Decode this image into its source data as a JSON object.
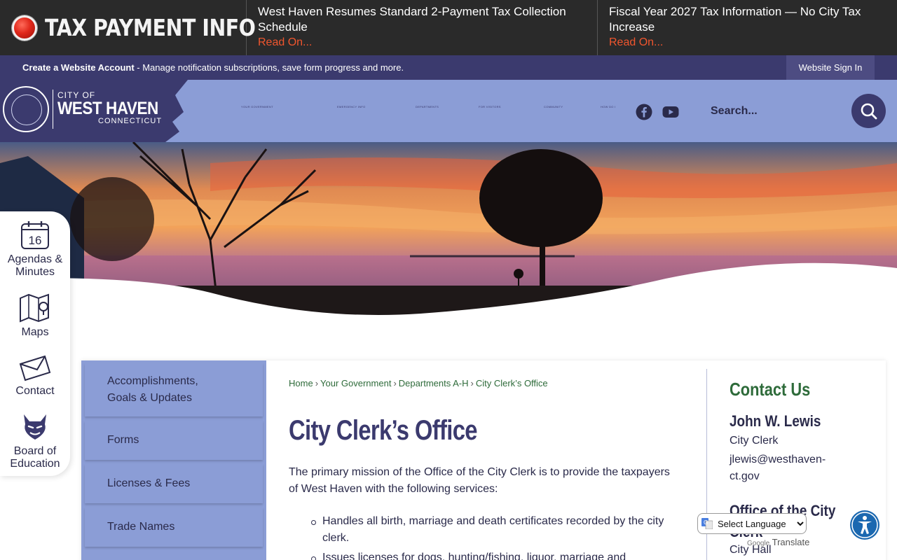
{
  "alert": {
    "label": "TAX PAYMENT INFO",
    "items": [
      {
        "text": "West Haven Resumes Standard 2-Payment Tax Collection Schedule",
        "link": "Read On..."
      },
      {
        "text": "Fiscal Year 2027 Tax Information — No City Tax Increase",
        "link": "Read On..."
      }
    ]
  },
  "account": {
    "create_link": "Create a Website Account",
    "description": " - Manage notification subscriptions, save form progress and more.",
    "signin_label": "Website Sign In"
  },
  "logo": {
    "city_of": "CITY OF",
    "name": "WEST HAVEN",
    "state": "CONNECTICUT"
  },
  "nav": {
    "items": [
      "YOUR GOVERNMENT",
      "EMERGENCY INFO",
      "DEPARTMENTS",
      "FOR VISITORS",
      "COMMUNITY",
      "HOW DO I"
    ]
  },
  "social": [
    "facebook-icon",
    "youtube-icon"
  ],
  "search": {
    "placeholder": "Search..."
  },
  "quicklinks": [
    {
      "label": "Agendas & Minutes",
      "icon": "calendar-icon",
      "day": "16"
    },
    {
      "label": "Maps",
      "icon": "map-icon"
    },
    {
      "label": "Contact",
      "icon": "envelope-icon"
    },
    {
      "label": "Board of Education",
      "icon": "devil-mascot-icon"
    }
  ],
  "sidenav": {
    "items": [
      "Accomplishments, Goals & Updates",
      "Forms",
      "Licenses & Fees",
      "Trade Names"
    ]
  },
  "breadcrumb": [
    "Home",
    "Your Government",
    "Departments A-H",
    "City Clerk’s Office"
  ],
  "page": {
    "title": "City Clerk’s Office",
    "intro": "The primary mission of the Office of the City Clerk is to provide the taxpayers of West Haven with the following services:",
    "services": [
      "Handles all birth, marriage and death certificates recorded by the city clerk.",
      "Issues licenses for dogs, hunting/fishing, liquor, marriage and"
    ]
  },
  "contact": {
    "title": "Contact Us",
    "name": "John W. Lewis",
    "role": "City Clerk",
    "email": "jlewis@westhaven-ct.gov",
    "office_title": "Office of the City Clerk",
    "office_address": "City Hall"
  },
  "translate": {
    "select_label": "Select Language",
    "powered_by": "Google",
    "powered_text": "Translate"
  },
  "colors": {
    "alert_bg": "#2a2a2a",
    "alert_link": "#f0562e",
    "brand_navy": "#3b3a6e",
    "brand_periwinkle": "#8b9dd6",
    "link_green": "#2e6b3a"
  }
}
